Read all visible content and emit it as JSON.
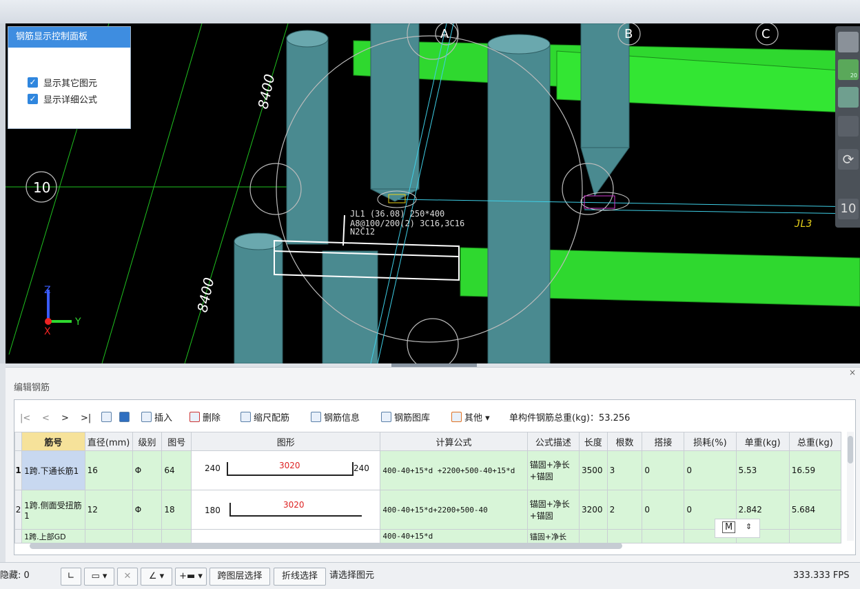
{
  "panel": {
    "title": "钢筋显示控制面板",
    "options": [
      {
        "label": "显示其它图元",
        "checked": true
      },
      {
        "label": "显示详细公式",
        "checked": true
      }
    ]
  },
  "viewport": {
    "axis_labels": [
      "A",
      "B",
      "C"
    ],
    "grid_label": "10",
    "dims": [
      "8400",
      "8400"
    ],
    "beam_label": "JL3",
    "rtool_label": "10",
    "rtool_small": "20",
    "coord": {
      "z": "Z",
      "y": "Y",
      "x": "X"
    }
  },
  "editor": {
    "title": "编辑钢筋",
    "close": "×",
    "toolbar": {
      "nav": [
        "|<",
        "<",
        ">",
        ">|"
      ],
      "insert": "插入",
      "delete": "删除",
      "scale": "缩尺配筋",
      "info": "钢筋信息",
      "library": "钢筋图库",
      "other": "其他",
      "total_label": "单构件钢筋总重(kg)：53.256"
    },
    "columns": [
      "筋号",
      "直径(mm)",
      "级别",
      "图号",
      "图形",
      "计算公式",
      "公式描述",
      "长度",
      "根数",
      "搭接",
      "损耗(%)",
      "单重(kg)",
      "总重(kg)"
    ],
    "rows": [
      {
        "no": "1",
        "name": "1跨.下通长筋1",
        "dia": "16",
        "grade": "Φ",
        "fig": "64",
        "left": "240",
        "mid": "3020",
        "right": "240",
        "formula": "400-40+15*d +2200+500-40+15*d",
        "desc": "锚固+净长+锚固",
        "len": "3500",
        "count": "3",
        "lap": "0",
        "loss": "0",
        "unit": "5.53",
        "total": "16.59"
      },
      {
        "no": "2",
        "name": "1跨.侧面受扭筋1",
        "dia": "12",
        "grade": "Φ",
        "fig": "18",
        "left": "180",
        "mid": "3020",
        "right": "",
        "formula": "400-40+15*d+2200+500-40",
        "desc": "锚固+净长+锚固",
        "len": "3200",
        "count": "2",
        "lap": "0",
        "loss": "0",
        "unit": "2.842",
        "total": "5.684"
      },
      {
        "no": "3",
        "name": "1跨.上部GD",
        "dia": "",
        "grade": "",
        "fig": "",
        "left": "",
        "mid": "",
        "right": "",
        "formula": "400-40+15*d",
        "desc": "锚固+净长",
        "len": "",
        "count": "",
        "lap": "",
        "loss": "",
        "unit": "",
        "total": ""
      }
    ],
    "m_label": "M"
  },
  "status": {
    "left_label": "隐藏: 0",
    "layer_btn": "跨图层选择",
    "poly_btn": "折线选择",
    "hint": "请选择图元",
    "fps": "333.333 FPS"
  }
}
